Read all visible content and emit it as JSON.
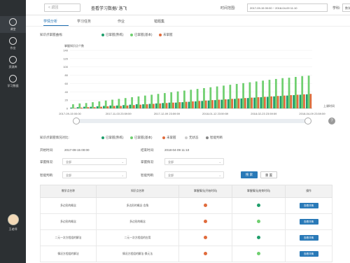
{
  "sidebar": {
    "items": [
      {
        "label": "课堂"
      },
      {
        "label": "作业"
      },
      {
        "label": "资源库"
      },
      {
        "label": "学习数据"
      }
    ],
    "user": {
      "label": "王老师"
    }
  },
  "header": {
    "back_label": "< 返回",
    "title": "查看学习数据/ 洛飞",
    "range_label": "时间范围:",
    "range_value": "2017-09-15 00:00  ~  2018-04-09 11:10",
    "subject_label": "学科:",
    "subject_value": "数学"
  },
  "tabs": [
    {
      "label": "学情分析"
    },
    {
      "label": "学习任务"
    },
    {
      "label": "作业"
    },
    {
      "label": "错题集"
    }
  ],
  "curve": {
    "label": "知识点掌握曲线:",
    "legend": [
      {
        "label": "已掌握(熟练)",
        "color": "#1f9e6b"
      },
      {
        "label": "已掌握(基本)",
        "color": "#6fcf6f"
      },
      {
        "label": "未掌握",
        "color": "#e06b3c"
      }
    ]
  },
  "chart_data": {
    "type": "bar",
    "ylabel": "掌握知识点个数",
    "xlabel": "上课时间",
    "ylim": [
      0,
      140
    ],
    "yticks": [
      0,
      20,
      40,
      60,
      80,
      100,
      120,
      140
    ],
    "xticks": [
      "2017-09-15 00:00",
      "2017-11-03 23:59:59",
      "2017-12-09 23:59:59",
      "2018-01-12 23:59:59",
      "2018-02-23 23:59:59",
      "2018-04-09 23:59:59"
    ],
    "series": [
      {
        "name": "已掌握(熟练)",
        "color": "#1f9e6b",
        "values": [
          2,
          3,
          4,
          4,
          5,
          6,
          7,
          7,
          8,
          9,
          10,
          10,
          11,
          12,
          13,
          14,
          14,
          15,
          16,
          17,
          18,
          19,
          20,
          21,
          22,
          23,
          24,
          25,
          26,
          27,
          28,
          29,
          30,
          31,
          32,
          33,
          34
        ]
      },
      {
        "name": "已掌握(基本)",
        "color": "#6fcf6f",
        "values": [
          10,
          12,
          13,
          15,
          17,
          19,
          21,
          23,
          25,
          27,
          29,
          31,
          33,
          35,
          37,
          39,
          41,
          43,
          45,
          47,
          49,
          51,
          53,
          55,
          57,
          59,
          61,
          63,
          65,
          67,
          69,
          71,
          73,
          74,
          76,
          78,
          79
        ]
      },
      {
        "name": "未掌握",
        "color": "#e06b3c",
        "values": [
          1,
          2,
          3,
          3,
          4,
          5,
          6,
          6,
          7,
          8,
          9,
          10,
          11,
          12,
          13,
          14,
          15,
          16,
          17,
          18,
          19,
          20,
          21,
          22,
          23,
          24,
          25,
          26,
          27,
          28,
          29,
          30,
          31,
          32,
          33,
          34,
          35
        ]
      }
    ]
  },
  "status": {
    "label": "知识点掌握情况对比:",
    "legend": [
      {
        "label": "已掌握(熟练)",
        "color": "#1f9e6b"
      },
      {
        "label": "已掌握(基本)",
        "color": "#6fcf6f"
      },
      {
        "label": "未掌握",
        "color": "#e06b3c"
      },
      {
        "label": "无状态",
        "color": "#cccccc"
      },
      {
        "label": "智能判断",
        "color": "#888888"
      }
    ]
  },
  "filters": {
    "start_label": "开始时间:",
    "start_value": "2017-09-15 00:00",
    "end_label": "结束时间:",
    "end_value": "2018-04-09 11:10",
    "master1_label": "掌握情况:",
    "master1_value": "全部",
    "master2_label": "掌握情况:",
    "master2_value": "全部",
    "judge1_label": "智能判断:",
    "judge1_value": "全部",
    "judge2_label": "智能判断:",
    "judge2_value": "全部",
    "search_label": "搜 索",
    "reset_label": "重 置"
  },
  "table": {
    "headers": [
      "教学点名称",
      "知识点名称",
      "掌握情况(开始时间)",
      "掌握情况(结束时间)",
      "操作"
    ],
    "rows": [
      {
        "lesson": "多边形的概念",
        "point": "多边形的概念·含角",
        "start_color": "#e06b3c",
        "end_color": "#1f9e6b",
        "action": "查看详情"
      },
      {
        "lesson": "多边形的概念",
        "point": "多边形的概念",
        "start_color": "#e06b3c",
        "end_color": "#6fcf6f",
        "action": "查看详情"
      },
      {
        "lesson": "二元一次方程组的解法",
        "point": "二元一次方程组的应用",
        "start_color": "#e06b3c",
        "end_color": "#1f9e6b",
        "action": "查看详情"
      },
      {
        "lesson": "情况方程组的解法",
        "point": "情况方程组的解法·换元法",
        "start_color": "#e06b3c",
        "end_color": "#6fcf6f",
        "action": "查看详情"
      }
    ]
  }
}
